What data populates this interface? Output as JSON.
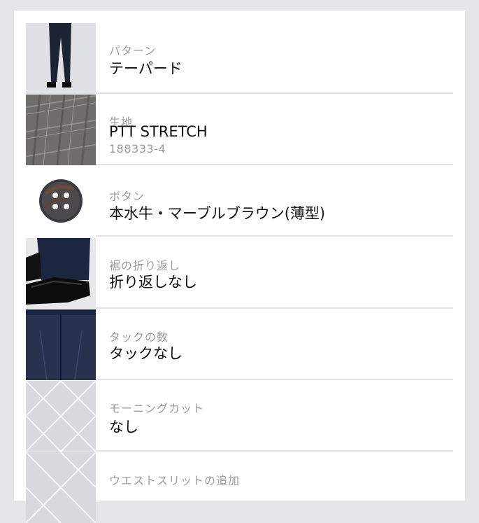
{
  "items": [
    {
      "label": "パターン",
      "value": "テーパード",
      "icon": "tapered-pants-icon"
    },
    {
      "label": "生地",
      "value": "PTT STRETCH",
      "code": "188333-4",
      "icon": "plaid-fabric-icon"
    },
    {
      "label": "ボタン",
      "value": "本水牛・マーブルブラウン(薄型)",
      "icon": "horn-button-icon"
    },
    {
      "label": "裾の折り返し",
      "value": "折り返しなし",
      "icon": "hem-shoe-icon"
    },
    {
      "label": "タックの数",
      "value": "タックなし",
      "icon": "no-tuck-trousers-icon"
    },
    {
      "label": "モーニングカット",
      "value": "なし",
      "icon": "placeholder-pattern-icon"
    },
    {
      "label": "ウエストスリットの追加",
      "value": "",
      "icon": "placeholder-pattern-icon"
    }
  ],
  "colors": {
    "background": "#e5e6e8",
    "panel": "#ffffff",
    "label": "#9c9c9c",
    "value": "#111111",
    "divider": "#e2e2e2"
  }
}
